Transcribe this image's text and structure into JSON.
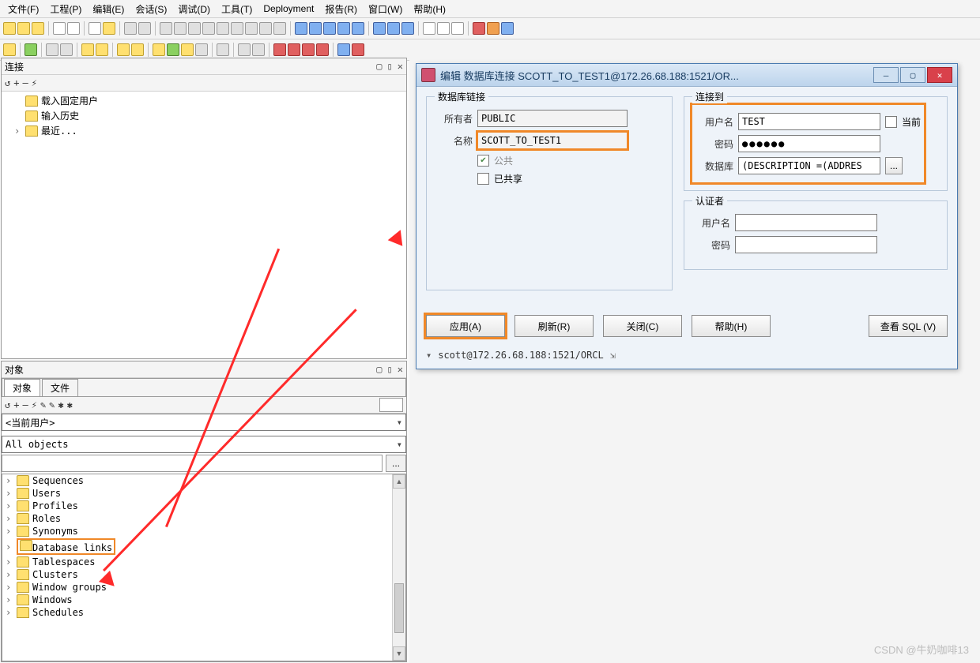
{
  "menubar": {
    "items": [
      "文件(F)",
      "工程(P)",
      "编辑(E)",
      "会话(S)",
      "调试(D)",
      "工具(T)",
      "Deployment",
      "报告(R)",
      "窗口(W)",
      "帮助(H)"
    ]
  },
  "panels": {
    "conn": {
      "title": "连接",
      "ctrls": [
        "▢",
        "▯",
        "✕"
      ],
      "tb": [
        "↺",
        "+",
        "–",
        "⚡"
      ],
      "tree": [
        "载入固定用户",
        "输入历史",
        "最近..."
      ]
    },
    "obj": {
      "title": "对象",
      "ctrls": [
        "▢",
        "▯",
        "✕"
      ],
      "tabs": [
        "对象",
        "文件"
      ],
      "tb": [
        "↺",
        "+",
        "–",
        "⚡",
        "✎",
        "✎",
        "✱",
        "✱"
      ],
      "user_combo": "<当前用户>",
      "scope_combo": "All objects",
      "dots": "...",
      "items": [
        "Sequences",
        "Users",
        "Profiles",
        "Roles",
        "Synonyms",
        "Database links",
        "Tablespaces",
        "Clusters",
        "Window groups",
        "Windows",
        "Schedules"
      ],
      "highlight_index": 5
    }
  },
  "dialog": {
    "title": "编辑 数据库连接 SCOTT_TO_TEST1@172.26.68.188:1521/OR...",
    "win_btns": {
      "min": "—",
      "max": "▢",
      "close": "✕"
    },
    "grp_link": {
      "legend": "数据库链接",
      "owner_label": "所有者",
      "owner_value": "PUBLIC",
      "name_label": "名称",
      "name_value": "SCOTT_TO_TEST1",
      "public_chk": "✔",
      "public_label": "公共",
      "shared_label": "已共享"
    },
    "grp_connect": {
      "legend": "连接到",
      "user_label": "用户名",
      "user_value": "TEST",
      "current_label": "当前",
      "pwd_label": "密码",
      "pwd_value": "●●●●●●",
      "db_label": "数据库",
      "db_value": "(DESCRIPTION =(ADDRES",
      "db_dots": "..."
    },
    "grp_auth": {
      "legend": "认证者",
      "user_label": "用户名",
      "pwd_label": "密码"
    },
    "buttons": {
      "apply": "应用(A)",
      "refresh": "刷新(R)",
      "close": "关闭(C)",
      "help": "帮助(H)",
      "viewsql": "查看 SQL (V)"
    },
    "status": "scott@172.26.68.188:1521/ORCL"
  },
  "watermark": "CSDN @牛奶咖啡13"
}
